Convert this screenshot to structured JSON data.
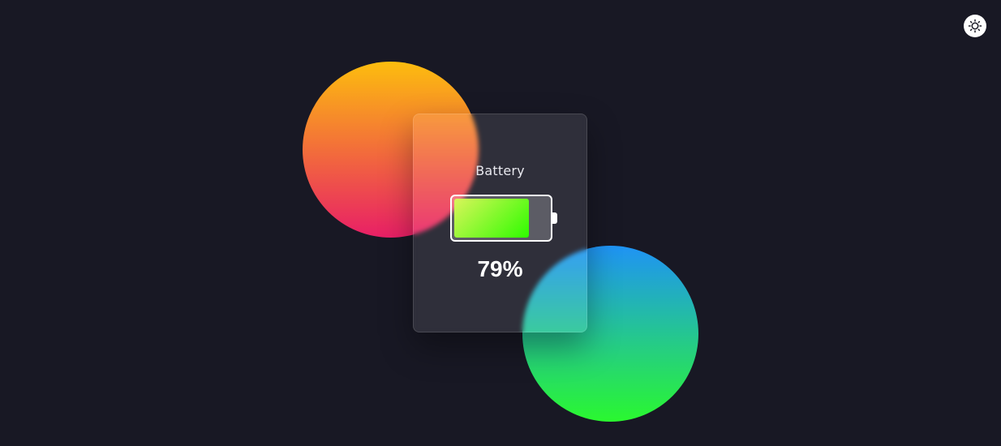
{
  "colors": {
    "background": "#181824",
    "text": "#ffffff",
    "card_title": "#e8e8ee",
    "orange_blob_top": "#fdbd0e",
    "orange_blob_bottom": "#e81f66",
    "green_blob_top": "#1f93f5",
    "green_blob_bottom": "#2af82f",
    "battery_fill_start": "#d9f55a",
    "battery_fill_end": "#2efc00",
    "battery_outline": "#ffffff",
    "toggle_bg": "#ffffff",
    "toggle_icon": "#181824"
  },
  "widget": {
    "title": "Battery",
    "level_percent": 79,
    "value_text": "79%"
  },
  "theme_toggle": {
    "icon": "sun-icon"
  }
}
